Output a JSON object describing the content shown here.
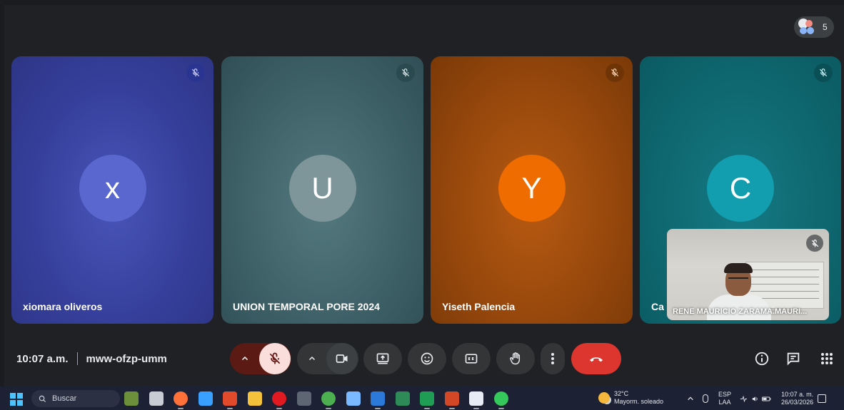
{
  "participants": {
    "count": "5",
    "tiles": [
      {
        "initial": "x",
        "name": "xiomara oliveros",
        "color": "#5a67cf"
      },
      {
        "initial": "U",
        "name": "UNION TEMPORAL PORE 2024",
        "color": "#7e969a"
      },
      {
        "initial": "Y",
        "name": "Yiseth Palencia",
        "color": "#ef6c00"
      },
      {
        "initial": "C",
        "name": "Ca",
        "color": "#129eaf"
      }
    ],
    "self_view": {
      "name": "RENE MAURICIO ZARAMA.MAURI..."
    }
  },
  "meeting": {
    "time": "10:07 a.m.",
    "code": "mww-ofzp-umm"
  },
  "controls": {
    "mic_state": "muted",
    "end_call_color": "#dc362e",
    "icons": [
      "chevron-up-icon",
      "mic-off-icon",
      "camera-icon",
      "present-icon",
      "emoji-icon",
      "captions-icon",
      "raise-hand-icon",
      "more-icon",
      "end-call-icon",
      "info-icon",
      "chat-icon",
      "apps-icon"
    ]
  },
  "taskbar": {
    "search_label": "Buscar",
    "weather_temp": "32°C",
    "weather_desc": "Mayorm. soleado",
    "lang_1": "ESP",
    "lang_2": "LAA",
    "clock_time": "10:07 a. m.",
    "clock_date": "26/03/2026",
    "app_icons": [
      {
        "name": "widgets-icon",
        "color": "#6b8f3a"
      },
      {
        "name": "task-view-icon",
        "color": "#c8ccd4"
      },
      {
        "name": "firefox-icon",
        "color": "#ff7139"
      },
      {
        "name": "copilot-icon",
        "color": "#3aa0ff"
      },
      {
        "name": "app-red-icon",
        "color": "#e24a2c"
      },
      {
        "name": "file-explorer-icon",
        "color": "#f3c13a"
      },
      {
        "name": "opera-icon",
        "color": "#e11a22"
      },
      {
        "name": "calculator-icon",
        "color": "#5f6673"
      },
      {
        "name": "chrome-icon",
        "color": "#4caf50"
      },
      {
        "name": "snipping-icon",
        "color": "#7ab8ff"
      },
      {
        "name": "word-icon",
        "color": "#2b79d8"
      },
      {
        "name": "project-icon",
        "color": "#2e8b57"
      },
      {
        "name": "excel-icon",
        "color": "#1f9d55"
      },
      {
        "name": "powerpoint-icon",
        "color": "#d24726"
      },
      {
        "name": "calendar-app-icon",
        "color": "#e8edf5"
      },
      {
        "name": "whatsapp-icon",
        "color": "#35c85a"
      }
    ]
  }
}
